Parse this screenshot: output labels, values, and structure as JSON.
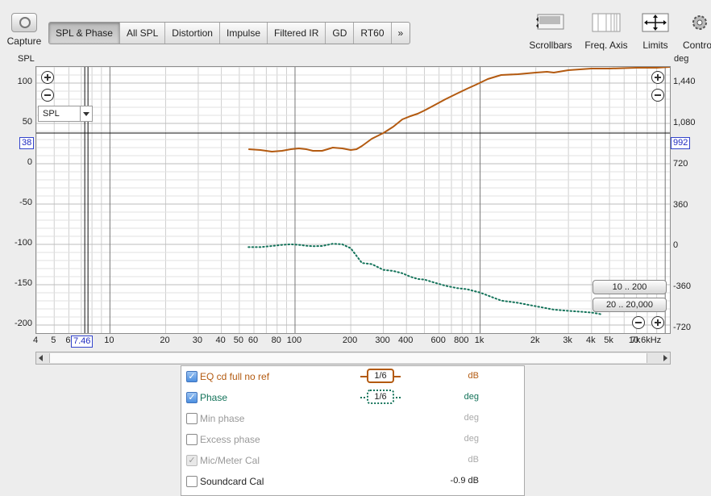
{
  "toolbar": {
    "capture_label": "Capture",
    "tabs": [
      "SPL & Phase",
      "All SPL",
      "Distortion",
      "Impulse",
      "Filtered IR",
      "GD",
      "RT60",
      "»"
    ],
    "scrollbars_label": "Scrollbars",
    "freq_axis_label": "Freq. Axis",
    "limits_label": "Limits",
    "controls_label": "Contro"
  },
  "graph": {
    "left_axis_title": "SPL",
    "right_axis_title": "deg",
    "spl_select": "SPL",
    "cursor_spl": "38",
    "cursor_phase": "992",
    "cursor_freq": "7.46",
    "range_buttons": [
      "10 .. 200",
      "20 .. 20,000"
    ]
  },
  "chart_data": {
    "type": "line",
    "title": "",
    "xlabel": "",
    "x_scale": "log",
    "xlim": [
      4,
      10600
    ],
    "x_ticks": [
      "4",
      "5",
      "6",
      "",
      "",
      "10",
      "20",
      "30",
      "40",
      "50",
      "60",
      "80",
      "100",
      "200",
      "300",
      "400",
      "600",
      "800",
      "1k",
      "2k",
      "3k",
      "4k",
      "5k",
      "7k",
      "10.6kHz"
    ],
    "ylim_left": [
      -210,
      120
    ],
    "ylim_right": [
      -756,
      1584
    ],
    "y_ticks_left": [
      "100",
      "50",
      "0",
      "-50",
      "-100",
      "-150",
      "-200"
    ],
    "y_ticks_right": [
      "1,440",
      "1,080",
      "720",
      "360",
      "0",
      "-360",
      "-720"
    ],
    "grid": true,
    "series": [
      {
        "name": "EQ cd full no ref",
        "axis": "left",
        "unit": "dB",
        "color": "#b35a10",
        "style": "solid",
        "x": [
          56,
          65,
          75,
          85,
          95,
          105,
          115,
          125,
          140,
          150,
          160,
          180,
          200,
          215,
          230,
          260,
          300,
          340,
          380,
          420,
          460,
          500,
          560,
          650,
          750,
          850,
          950,
          1100,
          1300,
          1600,
          2000,
          2300,
          2500,
          3000,
          4000,
          5000,
          7000,
          9000,
          10600
        ],
        "y": [
          18,
          17,
          15,
          16,
          18,
          19,
          18,
          16,
          16,
          18,
          20,
          19,
          17,
          18,
          22,
          31,
          38,
          46,
          55,
          59,
          62,
          66,
          72,
          80,
          87,
          93,
          98,
          105,
          110,
          111,
          113,
          114,
          113,
          116,
          118,
          118,
          119,
          119,
          120
        ]
      },
      {
        "name": "Phase",
        "axis": "right",
        "unit": "deg",
        "color": "#14735a",
        "style": "dotted",
        "x": [
          56,
          65,
          75,
          85,
          95,
          105,
          115,
          125,
          140,
          150,
          160,
          180,
          200,
          230,
          260,
          300,
          340,
          380,
          420,
          460,
          500,
          560,
          650,
          750,
          850,
          1000,
          1300,
          1600,
          2000,
          2500,
          3000,
          4000,
          4500
        ],
        "y": [
          0,
          0,
          10,
          20,
          25,
          20,
          12,
          8,
          10,
          20,
          30,
          25,
          -10,
          -140,
          -150,
          -200,
          -210,
          -230,
          -260,
          -280,
          -285,
          -310,
          -340,
          -360,
          -370,
          -400,
          -470,
          -490,
          -520,
          -550,
          -560,
          -575,
          -590
        ]
      }
    ]
  },
  "legend": {
    "rows": [
      {
        "name": "EQ cd full no ref",
        "checked": true,
        "smoothing": "1/6",
        "unit": "dB",
        "enabled": true
      },
      {
        "name": "Phase",
        "checked": true,
        "smoothing": "1/6",
        "unit": "deg",
        "enabled": true
      },
      {
        "name": "Min phase",
        "checked": false,
        "unit": "deg",
        "enabled": false
      },
      {
        "name": "Excess phase",
        "checked": false,
        "unit": "deg",
        "enabled": false
      },
      {
        "name": "Mic/Meter Cal",
        "checked": true,
        "unit": "dB",
        "enabled": false
      },
      {
        "name": "Soundcard Cal",
        "checked": false,
        "unit": "-0.9 dB",
        "enabled": true
      }
    ]
  },
  "colors": {
    "spl": "#b35a10",
    "phase": "#14735a",
    "cursor": "#1f2ac0"
  }
}
